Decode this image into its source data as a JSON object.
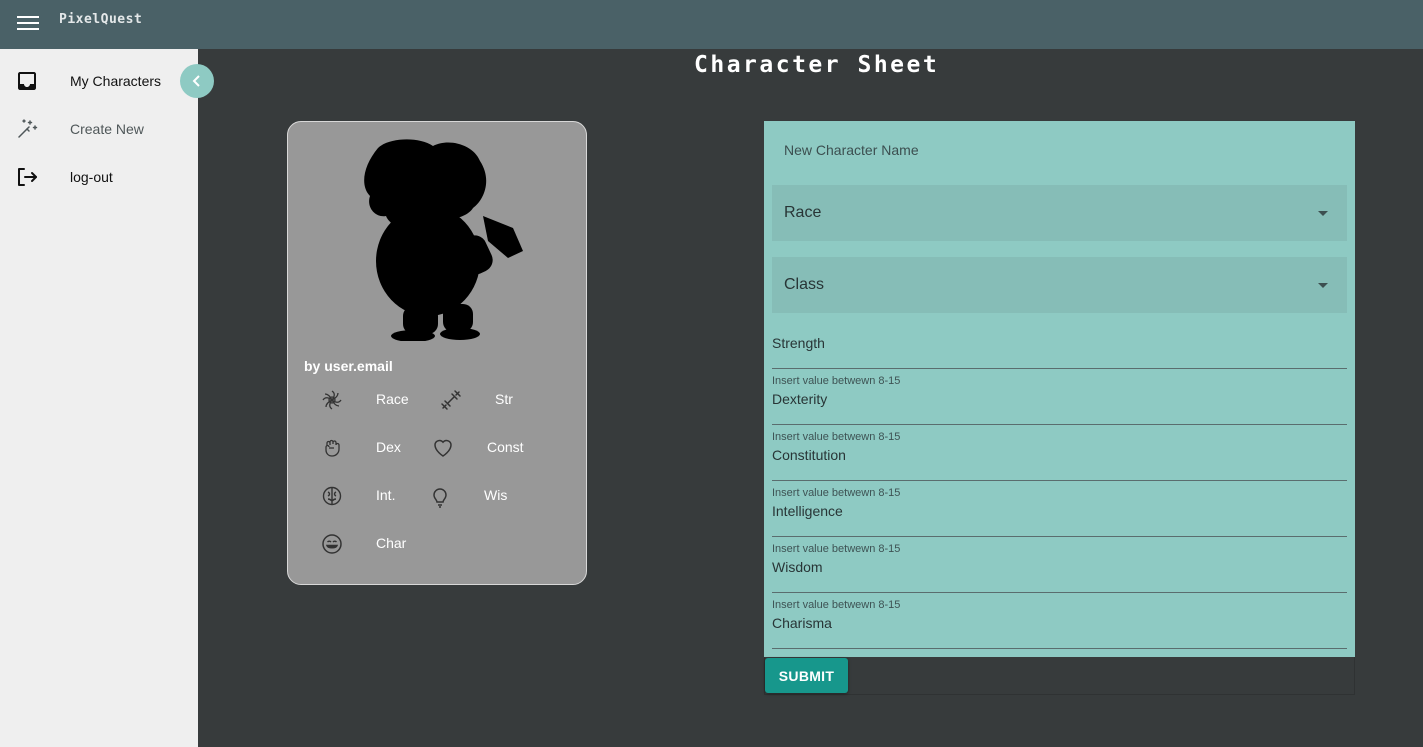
{
  "app": {
    "title": "PixelQuest"
  },
  "sidebar": {
    "items": [
      {
        "label": "My Characters",
        "icon": "inbox-icon"
      },
      {
        "label": "Create New",
        "icon": "magic-wand-icon"
      },
      {
        "label": "log-out",
        "icon": "logout-icon"
      }
    ],
    "collapse_icon": "chevron-left-icon"
  },
  "page": {
    "title": "Character Sheet"
  },
  "card": {
    "author": "by user.email",
    "stats": [
      {
        "label": "Race",
        "icon": "race-icon"
      },
      {
        "label": "Str",
        "icon": "dumbbell-icon"
      },
      {
        "label": "Dex",
        "icon": "fist-icon"
      },
      {
        "label": "Const",
        "icon": "heart-icon"
      },
      {
        "label": "Int.",
        "icon": "brain-icon"
      },
      {
        "label": "Wis",
        "icon": "lightbulb-icon"
      },
      {
        "label": "Char",
        "icon": "smile-icon"
      }
    ]
  },
  "form": {
    "name_placeholder": "New Character Name",
    "race_label": "Race",
    "class_label": "Class",
    "fields": [
      {
        "hint": "",
        "label": "Strength"
      },
      {
        "hint": "Insert value betwewn 8-15",
        "label": "Dexterity"
      },
      {
        "hint": "Insert value betwewn 8-15",
        "label": "Constitution"
      },
      {
        "hint": "Insert value betwewn 8-15",
        "label": "Intelligence"
      },
      {
        "hint": "Insert value betwewn 8-15",
        "label": "Wisdom"
      },
      {
        "hint": "Insert value betwewn 8-15",
        "label": "Charisma"
      }
    ],
    "submit_label": "SUBMIT"
  },
  "colors": {
    "appbar": "#4a6167",
    "background": "#373b3c",
    "sidebar": "#efefef",
    "accent": "#8ecac3",
    "button": "#17978c",
    "card": "#989898"
  }
}
